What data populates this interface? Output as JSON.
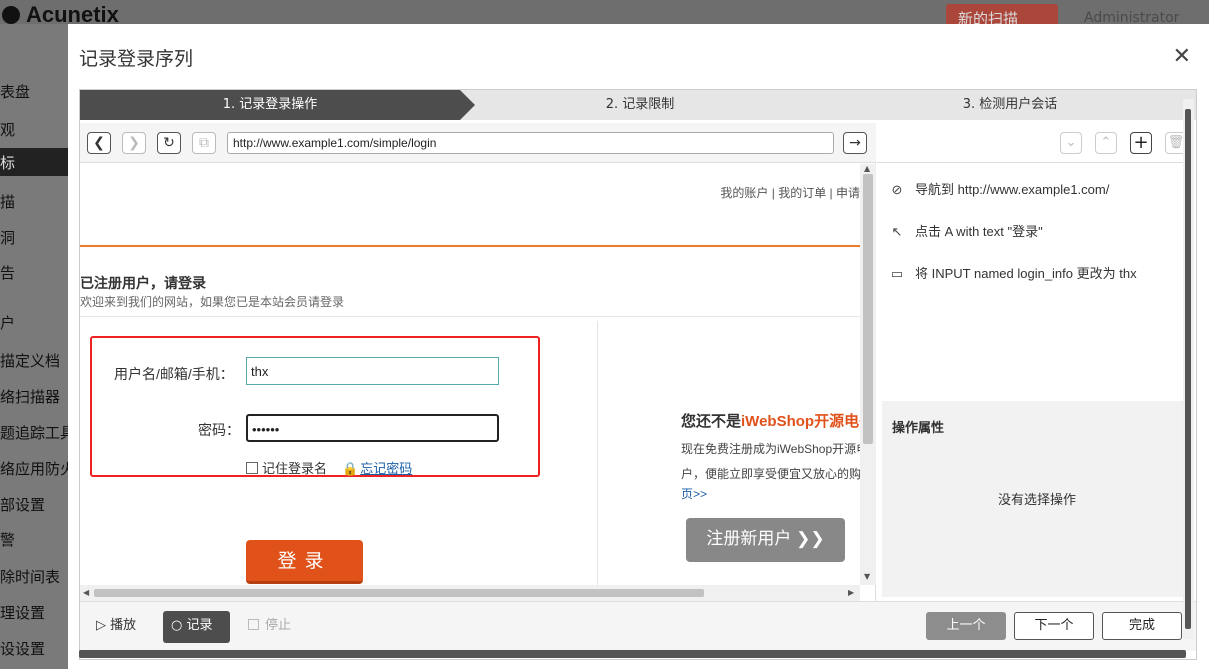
{
  "background": {
    "logo": "Acunetix",
    "new_scan": "新的扫描",
    "user": "Administrator zone",
    "sidebar": [
      "表盘",
      "观",
      "标",
      "描",
      "洞",
      "告",
      "户",
      "描定义档",
      "络扫描器",
      "题追踪工具",
      "络应用防火",
      "部设置",
      "警",
      "除时间表",
      "理设置",
      "设设置"
    ]
  },
  "modal": {
    "title": "记录登录序列",
    "steps": [
      "1. 记录登录操作",
      "2. 记录限制",
      "3. 检测用户会话"
    ],
    "url": "http://www.example1.com/simple/login",
    "page": {
      "top_links": "我的账户 |   我的订单 |   申请",
      "section_title": "已注册用户，请登录",
      "section_sub": "欢迎来到我们的网站，如果您已是本站会员请登录",
      "username_label": "用户名/邮箱/手机：",
      "username_value": "thx",
      "password_label": "密码：",
      "password_value": "••••••",
      "remember_label": "记住登录名",
      "forgot_label": "忘记密码",
      "login_button": "登录",
      "reg_prefix": "您还不是",
      "reg_brand": "iWebShop开源电子",
      "reg_line1": "现在免费注册成为iWebShop开源电",
      "reg_line2": "户，便能立即享受便宜又放心的购",
      "reg_more": "页>>",
      "reg_button": "注册新用户 ❯❯"
    },
    "actions": [
      {
        "icon": "compass-icon",
        "text": "导航到 http://www.example1.com/"
      },
      {
        "icon": "cursor-icon",
        "text": "点击 A with text \"登录\""
      },
      {
        "icon": "input-icon",
        "text": "将 INPUT named login_info 更改为 thx"
      }
    ],
    "props_title": "操作属性",
    "props_empty": "没有选择操作",
    "bottom": {
      "play": "播放",
      "record": "记录",
      "stop": "停止",
      "prev": "上一个",
      "next": "下一个",
      "done": "完成"
    }
  }
}
